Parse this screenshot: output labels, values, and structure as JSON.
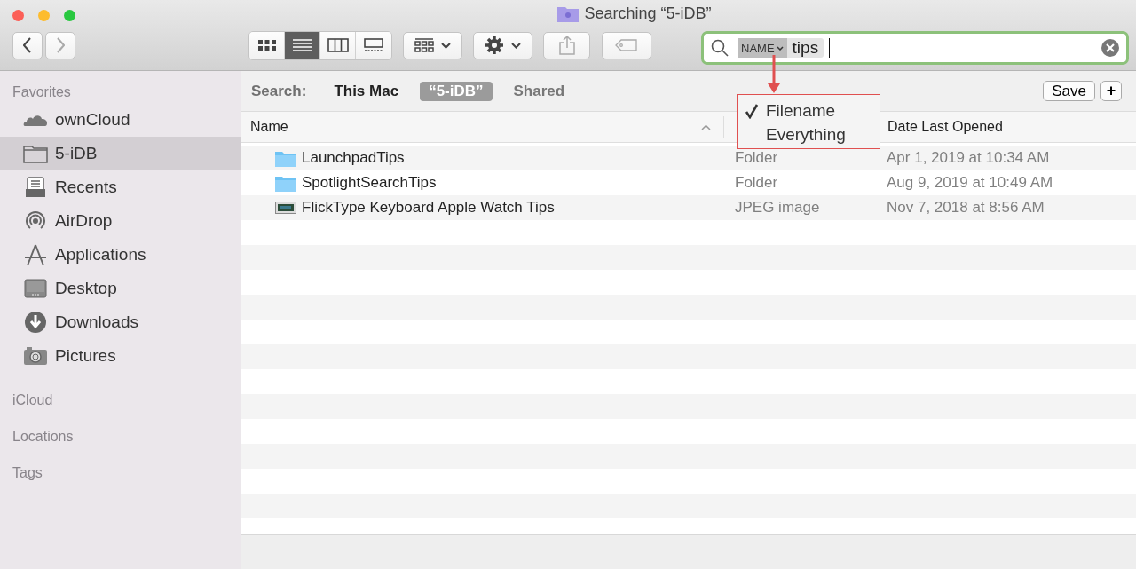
{
  "window": {
    "title": "Searching “5-iDB”"
  },
  "toolbar": {
    "view_modes": [
      {
        "kind": "icons",
        "selected": false
      },
      {
        "kind": "list",
        "selected": true
      },
      {
        "kind": "columns",
        "selected": false
      },
      {
        "kind": "gallery",
        "selected": false
      }
    ]
  },
  "search": {
    "token": "NAME",
    "value": "tips",
    "menu": [
      {
        "label": "Filename",
        "checked": true
      },
      {
        "label": "Everything",
        "checked": false
      }
    ]
  },
  "sidebar": {
    "sections": [
      {
        "title": "Favorites",
        "items": [
          {
            "label": "ownCloud",
            "kind": "cloud",
            "selected": false
          },
          {
            "label": "5-iDB",
            "kind": "folder",
            "selected": true
          },
          {
            "label": "Recents",
            "kind": "recents",
            "selected": false
          },
          {
            "label": "AirDrop",
            "kind": "airdrop",
            "selected": false
          },
          {
            "label": "Applications",
            "kind": "apps",
            "selected": false
          },
          {
            "label": "Desktop",
            "kind": "desktop",
            "selected": false
          },
          {
            "label": "Downloads",
            "kind": "downloads",
            "selected": false
          },
          {
            "label": "Pictures",
            "kind": "camera",
            "selected": false
          }
        ]
      },
      {
        "title": "iCloud"
      },
      {
        "title": "Locations"
      },
      {
        "title": "Tags"
      }
    ]
  },
  "scope": {
    "label": "Search:",
    "options": [
      {
        "label": "This Mac",
        "selected": false,
        "disabled": false
      },
      {
        "label": "“5-iDB”",
        "selected": true,
        "disabled": false
      },
      {
        "label": "Shared",
        "selected": false,
        "disabled": true
      }
    ],
    "save": "Save",
    "add": "+"
  },
  "table": {
    "columns": [
      {
        "label": "Name",
        "sorted": true
      },
      {
        "label": "Date Last Opened",
        "sorted": false
      }
    ],
    "rows": [
      {
        "name": "LaunchpadTips",
        "kind": "folder",
        "column_2": "Folder",
        "date": "Apr 1, 2019 at 10:34 AM"
      },
      {
        "name": "SpotlightSearchTips",
        "kind": "folder",
        "column_2": "Folder",
        "date": "Aug 9, 2019 at 10:49 AM"
      },
      {
        "name": "FlickType Keyboard Apple Watch Tips",
        "kind": "image",
        "column_2": "JPEG image",
        "date": "Nov 7, 2018 at 8:56 AM"
      }
    ]
  }
}
